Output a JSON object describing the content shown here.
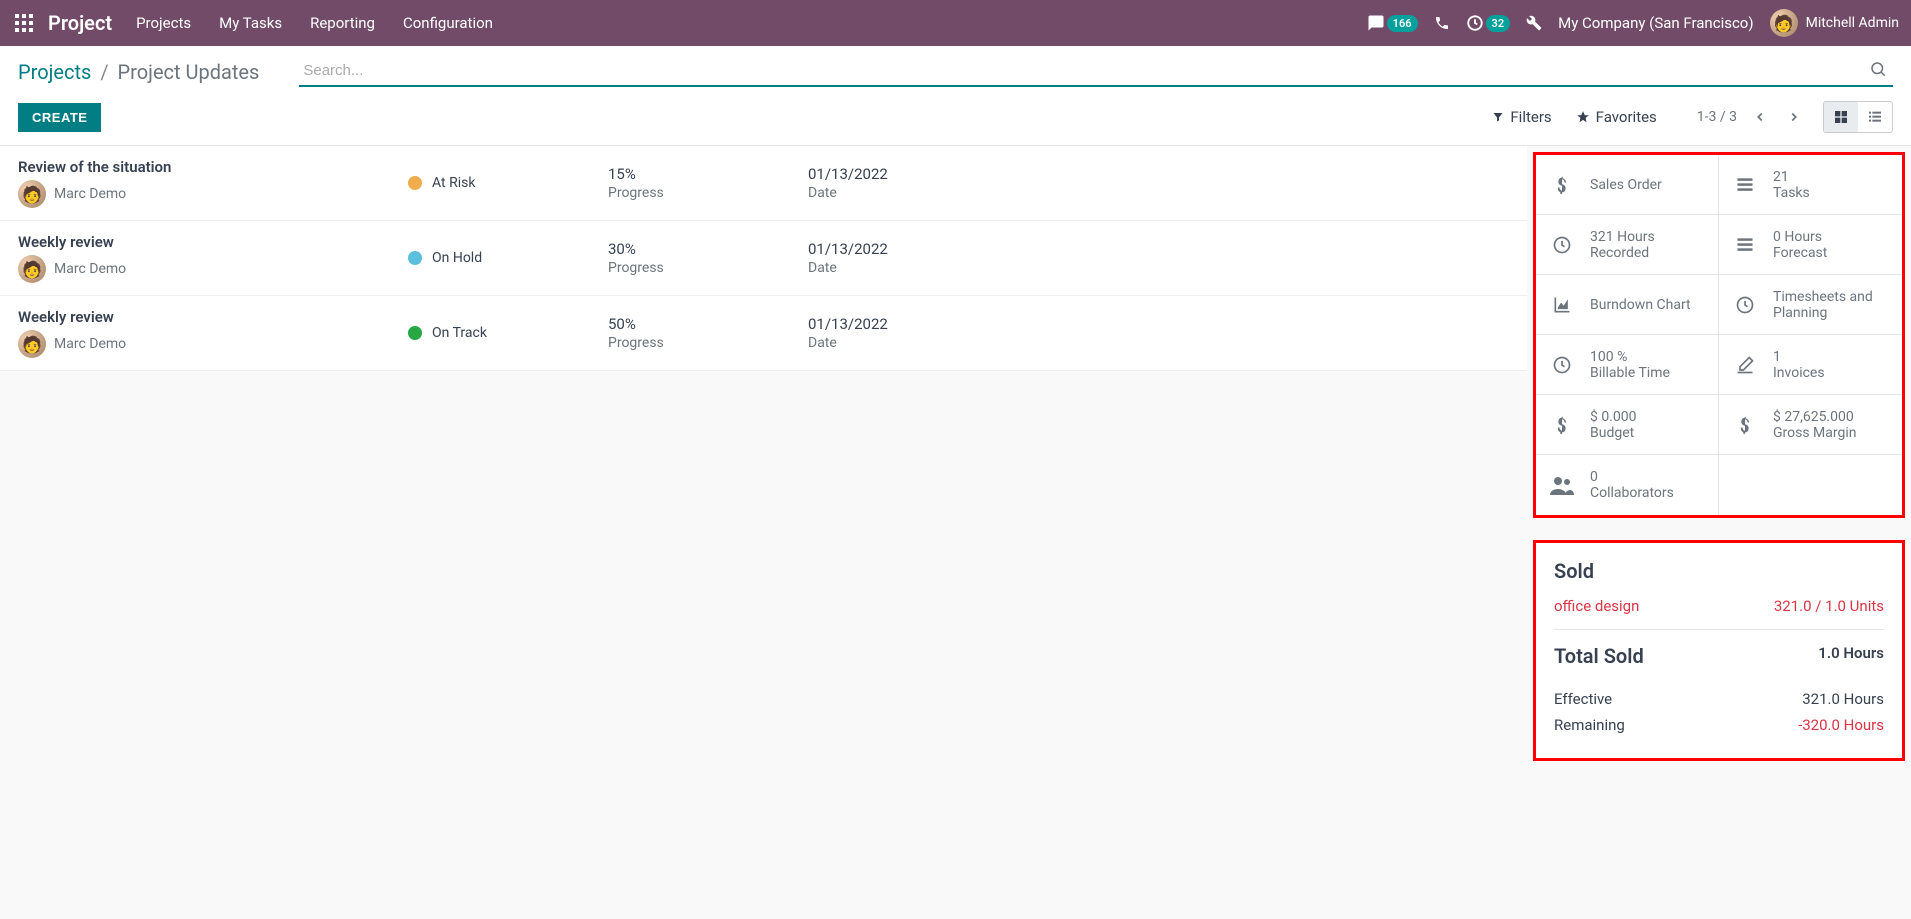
{
  "topbar": {
    "brand": "Project",
    "menu": [
      "Projects",
      "My Tasks",
      "Reporting",
      "Configuration"
    ],
    "messages_count": "166",
    "activities_count": "32",
    "company": "My Company (San Francisco)",
    "user": "Mitchell Admin"
  },
  "breadcrumb": {
    "root": "Projects",
    "current": "Project Updates"
  },
  "toolbar": {
    "create": "CREATE",
    "filters": "Filters",
    "favorites": "Favorites",
    "search_placeholder": "Search...",
    "pager": "1-3 / 3"
  },
  "updates": [
    {
      "title": "Review of the situation",
      "author": "Marc Demo",
      "status": "At Risk",
      "status_color": "#f0ad4e",
      "progress": "15%",
      "progress_lbl": "Progress",
      "date": "01/13/2022",
      "date_lbl": "Date"
    },
    {
      "title": "Weekly review",
      "author": "Marc Demo",
      "status": "On Hold",
      "status_color": "#5bc0de",
      "progress": "30%",
      "progress_lbl": "Progress",
      "date": "01/13/2022",
      "date_lbl": "Date"
    },
    {
      "title": "Weekly review",
      "author": "Marc Demo",
      "status": "On Track",
      "status_color": "#28a745",
      "progress": "50%",
      "progress_lbl": "Progress",
      "date": "01/13/2022",
      "date_lbl": "Date"
    }
  ],
  "stats": [
    {
      "icon": "dollar-icon",
      "val": "",
      "lbl": "Sales Order"
    },
    {
      "icon": "tasks-icon",
      "val": "21",
      "lbl": "Tasks"
    },
    {
      "icon": "clock-icon",
      "val": "321 Hours",
      "lbl": "Recorded"
    },
    {
      "icon": "tasks-icon",
      "val": "0 Hours",
      "lbl": "Forecast"
    },
    {
      "icon": "area-chart-icon",
      "val": "",
      "lbl": "Burndown Chart"
    },
    {
      "icon": "clock-icon",
      "val": "",
      "lbl": "Timesheets and Planning"
    },
    {
      "icon": "clock-icon",
      "val": "100 %",
      "lbl": "Billable Time"
    },
    {
      "icon": "pencil-icon",
      "val": "1",
      "lbl": "Invoices"
    },
    {
      "icon": "dollar-icon",
      "val": "$ 0.000",
      "lbl": "Budget"
    },
    {
      "icon": "dollar-icon",
      "val": "$ 27,625.000",
      "lbl": "Gross Margin"
    },
    {
      "icon": "users-icon",
      "val": "0",
      "lbl": "Collaborators"
    },
    {
      "icon": "",
      "val": "",
      "lbl": ""
    }
  ],
  "sold": {
    "heading": "Sold",
    "item_name": "office design",
    "item_val": "321.0 / 1.0 Units",
    "total_heading": "Total Sold",
    "total_val": "1.0 Hours",
    "effective_lbl": "Effective",
    "effective_val": "321.0 Hours",
    "remaining_lbl": "Remaining",
    "remaining_val": "-320.0 Hours"
  }
}
